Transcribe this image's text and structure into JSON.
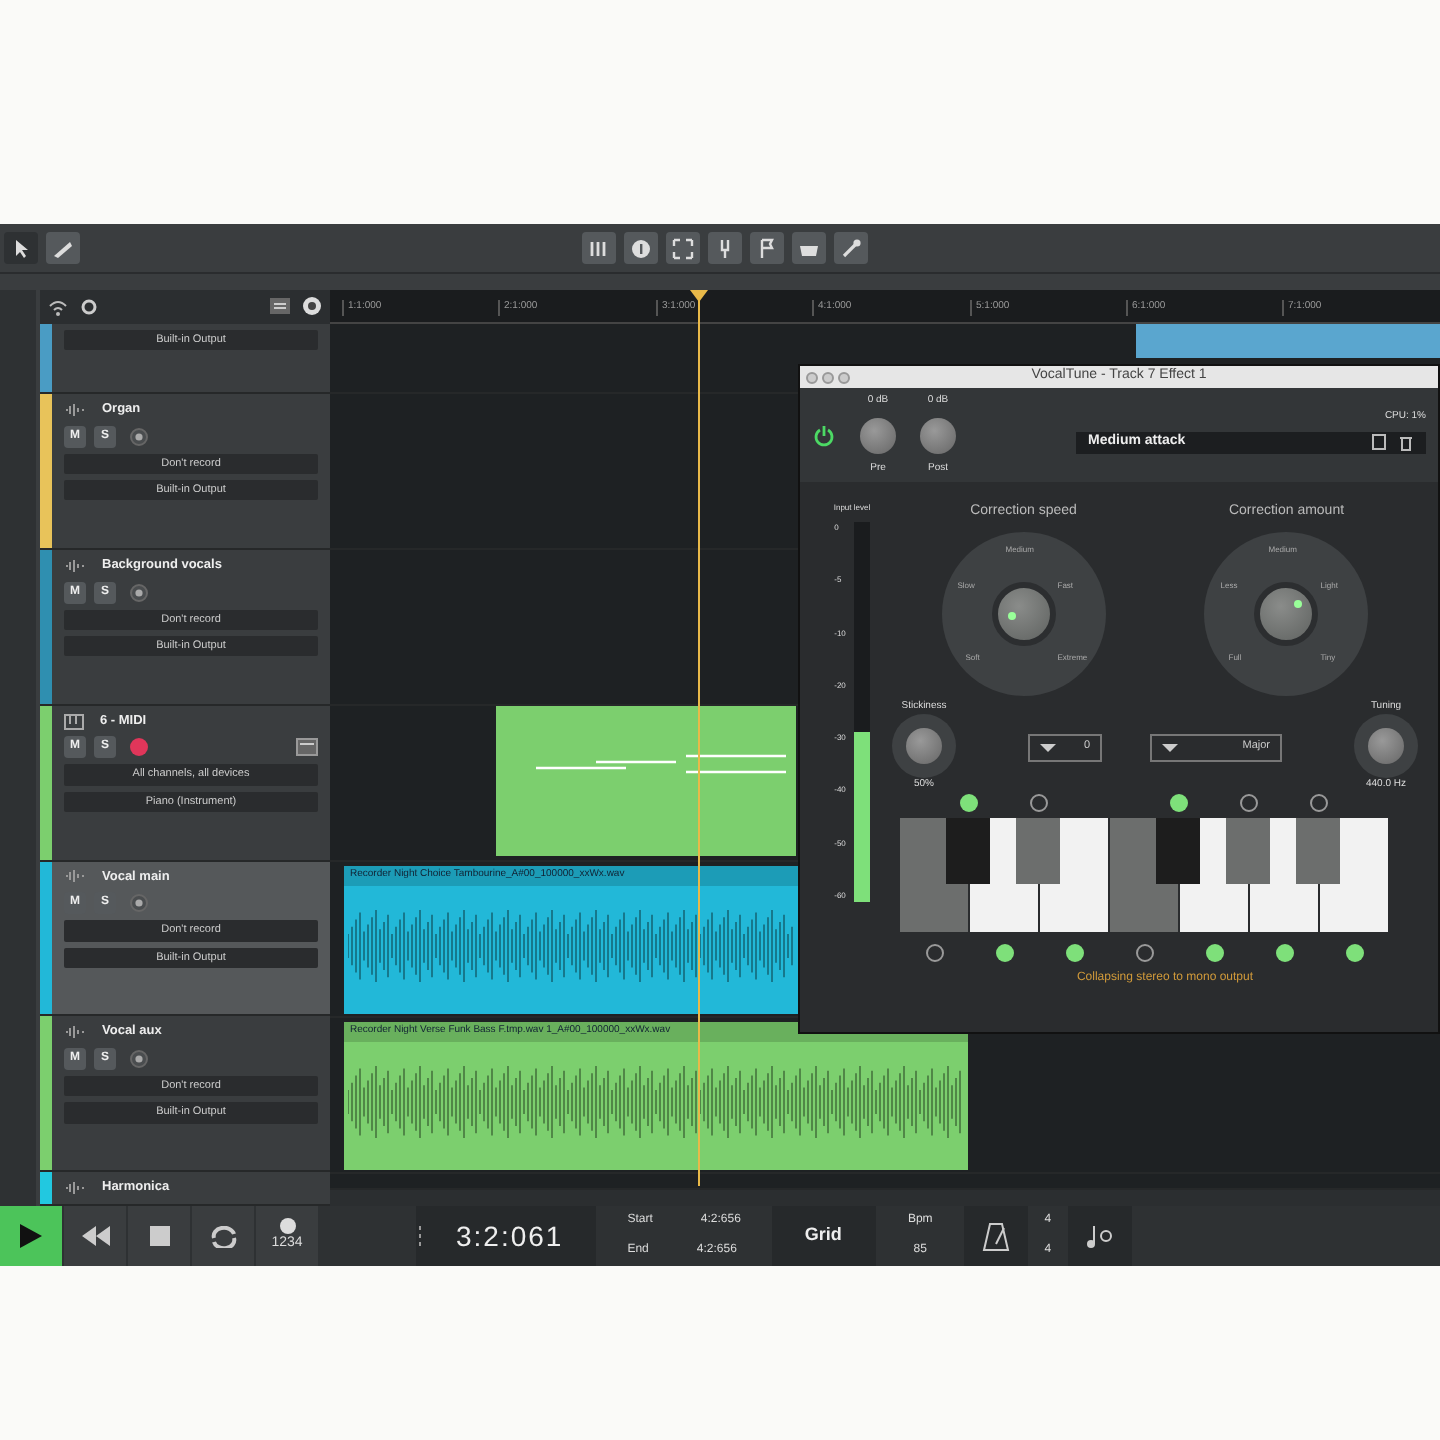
{
  "ruler": {
    "labels": [
      "1:1:000",
      "2:1:000",
      "3:1:000",
      "4:1:000",
      "5:1:000",
      "6:1:000",
      "7:1:000"
    ]
  },
  "tracks": [
    {
      "color": "#4a9cc4",
      "selected": false,
      "output": "Built-in Output",
      "clips": [
        {
          "kind": "audio",
          "color": "#5aa6cf"
        }
      ]
    },
    {
      "kind": "audio",
      "name": "Organ",
      "color": "#e8c35a",
      "selected": false,
      "mute_label": "M",
      "solo_label": "S",
      "record_armed": false,
      "input": "Don't record",
      "output": "Built-in Output"
    },
    {
      "kind": "audio",
      "name": "Background vocals",
      "color": "#2f8fb0",
      "selected": false,
      "mute_label": "M",
      "solo_label": "S",
      "record_armed": false,
      "input": "Don't record",
      "output": "Built-in Output"
    },
    {
      "kind": "midi",
      "name": "6 - MIDI",
      "color": "#7ccf6e",
      "selected": false,
      "mute_label": "M",
      "solo_label": "S",
      "record_armed": true,
      "input": "All channels, all devices",
      "output": "Piano (Instrument)",
      "clips": [
        {
          "kind": "midi",
          "color": "#7ccf6e"
        }
      ]
    },
    {
      "kind": "audio",
      "name": "Vocal main",
      "color": "#22b8d8",
      "selected": true,
      "mute_label": "M",
      "solo_label": "S",
      "record_armed": false,
      "input": "Don't record",
      "output": "Built-in Output",
      "clips": [
        {
          "kind": "audio",
          "color": "#22b8d8",
          "label": "Recorder Night Choice Tambourine_A#00_100000_xxWx.wav"
        }
      ]
    },
    {
      "kind": "audio",
      "name": "Vocal aux",
      "color": "#7ccf6e",
      "selected": false,
      "mute_label": "M",
      "solo_label": "S",
      "record_armed": false,
      "input": "Don't record",
      "output": "Built-in Output",
      "clips": [
        {
          "kind": "audio",
          "color": "#7ccf6e",
          "label": "Recorder Night Verse Funk Bass F.tmp.wav 1_A#00_100000_xxWx.wav"
        }
      ]
    },
    {
      "kind": "audio",
      "name": "Harmonica",
      "color": "#22c8e0",
      "selected": false
    }
  ],
  "plugin": {
    "title": "VocalTune - Track 7 Effect 1",
    "power_on": true,
    "pre_gain": "0 dB",
    "pre_label": "Pre",
    "post_gain": "0 dB",
    "post_label": "Post",
    "cpu": "CPU: 1%",
    "preset": "Medium attack",
    "meter_label": "Input level",
    "meter_scale": [
      "0",
      "-5",
      "-10",
      "-20",
      "-30",
      "-40",
      "-50",
      "-60"
    ],
    "input_meter": {
      "level": 0.45
    },
    "dials": [
      {
        "title": "Correction speed",
        "labels": [
          "Medium",
          "Slow",
          "Fast",
          "Soft",
          "Extreme"
        ]
      },
      {
        "title": "Correction amount",
        "labels": [
          "Medium",
          "Less",
          "Light",
          "Full",
          "Tiny"
        ]
      }
    ],
    "stickiness_label": "Stickiness",
    "stickiness_value": "50%",
    "key_root": "0",
    "scale": "Major",
    "tuning_label": "Tuning",
    "tuning_value": "440.0 Hz",
    "keys": [
      {
        "kind": "white",
        "on": false
      },
      {
        "kind": "black",
        "on": true
      },
      {
        "kind": "white",
        "on": true
      },
      {
        "kind": "black",
        "on": false
      },
      {
        "kind": "white",
        "on": true
      },
      {
        "kind": "white",
        "on": false
      },
      {
        "kind": "black",
        "on": true
      },
      {
        "kind": "white",
        "on": true
      },
      {
        "kind": "black",
        "on": false
      },
      {
        "kind": "white",
        "on": true
      },
      {
        "kind": "black",
        "on": false
      },
      {
        "kind": "white",
        "on": true
      }
    ],
    "footer": "Collapsing stereo to mono output"
  },
  "transport": {
    "playing": true,
    "count_in": "1234",
    "time": "3:2:061",
    "start_label": "Start",
    "start": "4:2:656",
    "end_label": "End",
    "end": "4:2:656",
    "grid": "Grid",
    "bpm_label": "Bpm",
    "bpm": "85",
    "time_signature": [
      "4",
      "4"
    ]
  }
}
